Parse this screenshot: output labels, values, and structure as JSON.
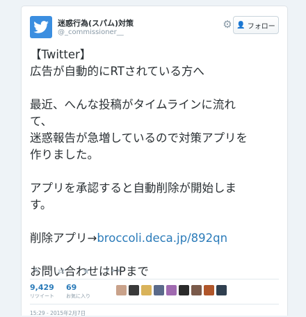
{
  "account": {
    "name": "迷惑行為(スパム)対策",
    "handle": "@_commissioner__"
  },
  "follow_button": {
    "label": "フォロー"
  },
  "tweet": {
    "line1": "【Twitter】",
    "line2": " 広告が自動的にRTされている方へ",
    "para2_line1": "最近、へんな投稿がタイムラインに流れ",
    "para2_line2": "て、",
    "para2_line3": "迷惑報告が急増しているので対策アプリを",
    "para2_line4": "作りました。",
    "para3_line1": "アプリを承認すると自動削除が開始しま",
    "para3_line2": "す。",
    "delete_prefix": "削除アプリ→",
    "link": "broccoli.deca.jp/892qn",
    "contact": "お問い合わせはHPまで"
  },
  "stats": {
    "retweets_count": "9,429",
    "retweets_label": "リツイート",
    "favorites_count": "69",
    "favorites_label": "お気に入り"
  },
  "favoriter_avatar_colors": [
    "#c9a28a",
    "#3a3a3a",
    "#d9b35a",
    "#5a6a8a",
    "#a06ab0",
    "#2a2a2a",
    "#7a5a4a",
    "#b0562a",
    "#2f3f4f"
  ],
  "timestamp": "15:29 - 2015年2月7日",
  "colors": {
    "link": "#2b7bb9",
    "brand": "#55acee",
    "text": "#292f33",
    "muted": "#8899a6"
  },
  "icons": [
    "twitter-bird-icon",
    "gear-icon",
    "follow-person-icon",
    "reply-icon",
    "retweet-icon",
    "favorite-icon",
    "more-icon"
  ]
}
